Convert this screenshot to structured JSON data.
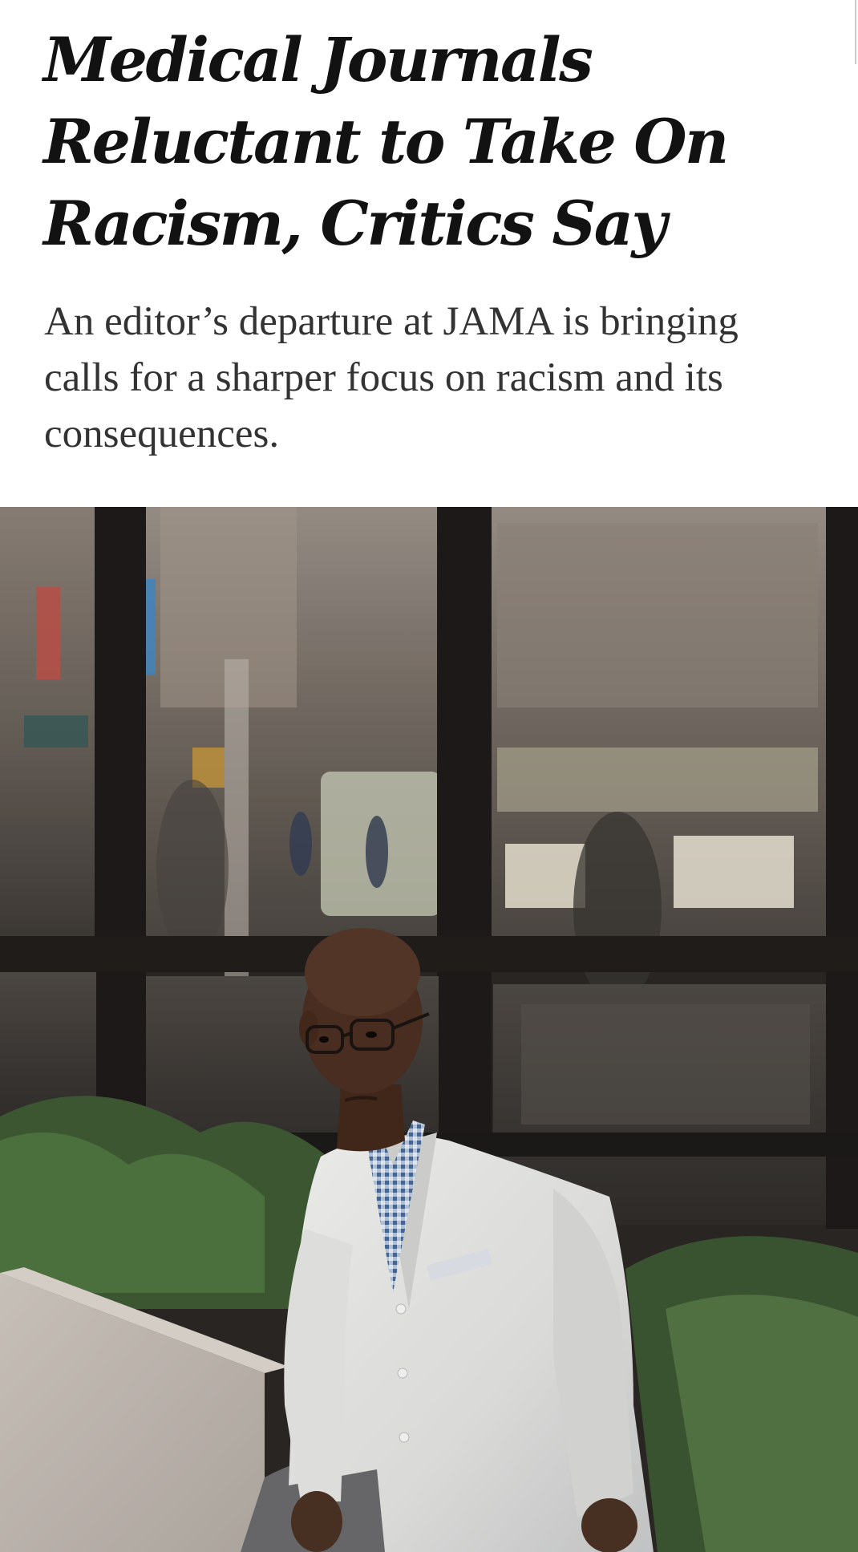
{
  "article": {
    "headline": "Medical Journals Reluctant to Take On Racism, Critics Say",
    "summary": "An editor’s departure at JAMA is bringing calls for a sharper focus on racism and its consequences."
  },
  "photo": {
    "subject": "man in white lab coat seated in front of window"
  },
  "colors": {
    "text": "#121212",
    "summary_text": "#333333",
    "background": "#ffffff"
  }
}
